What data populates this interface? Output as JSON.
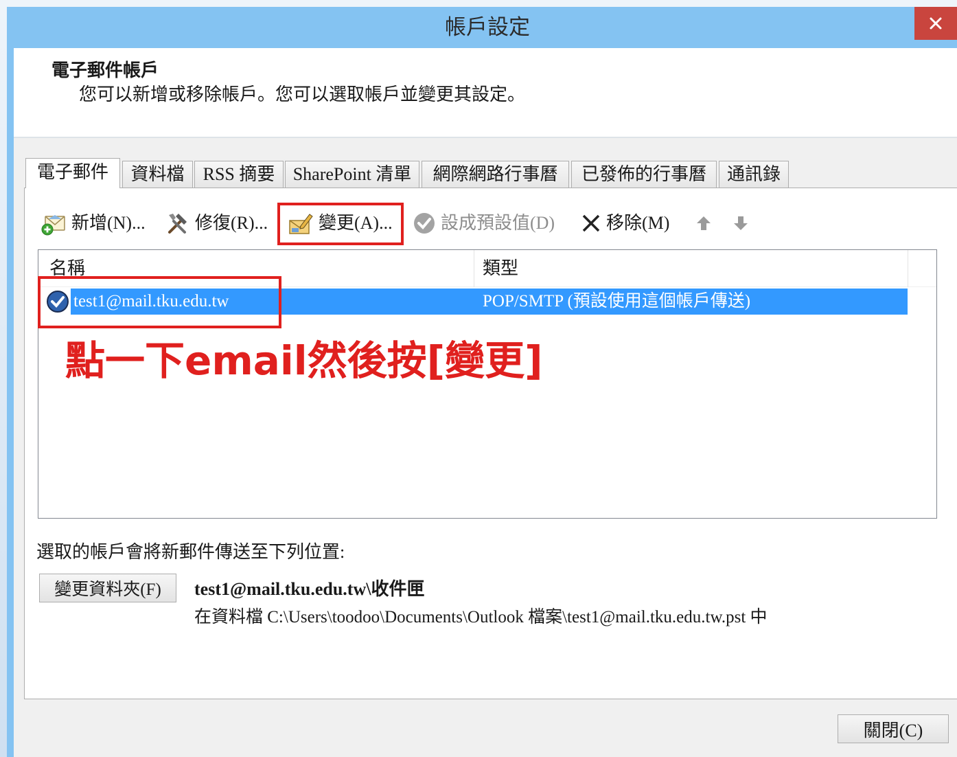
{
  "window": {
    "title": "帳戶設定",
    "close_icon": "close-icon"
  },
  "header": {
    "title": "電子郵件帳戶",
    "subtitle": "您可以新增或移除帳戶。您可以選取帳戶並變更其設定。"
  },
  "tabs": [
    {
      "label": "電子郵件",
      "selected": true
    },
    {
      "label": "資料檔",
      "selected": false
    },
    {
      "label": "RSS 摘要",
      "selected": false
    },
    {
      "label": "SharePoint 清單",
      "selected": false
    },
    {
      "label": "網際網路行事曆",
      "selected": false
    },
    {
      "label": "已發佈的行事曆",
      "selected": false
    },
    {
      "label": "通訊錄",
      "selected": false
    }
  ],
  "toolbar": {
    "new": {
      "label": "新增(N)...",
      "icon": "new-account-icon",
      "enabled": true
    },
    "repair": {
      "label": "修復(R)...",
      "icon": "repair-icon",
      "enabled": true
    },
    "change": {
      "label": "變更(A)...",
      "icon": "change-account-icon",
      "enabled": true
    },
    "set_default": {
      "label": "設成預設值(D)",
      "icon": "set-default-icon",
      "enabled": false
    },
    "remove": {
      "label": "移除(M)",
      "icon": "remove-icon",
      "enabled": true
    },
    "move_up": {
      "icon": "arrow-up-icon",
      "enabled": false
    },
    "move_down": {
      "icon": "arrow-down-icon",
      "enabled": false
    }
  },
  "account_list": {
    "columns": [
      "名稱",
      "類型"
    ],
    "rows": [
      {
        "name": "test1@mail.tku.edu.tw",
        "type": "POP/SMTP (預設使用這個帳戶傳送)",
        "selected": true,
        "icon": "default-account-icon"
      }
    ]
  },
  "annotation": {
    "text": "點一下email然後按[變更]"
  },
  "delivery": {
    "label": "選取的帳戶會將新郵件傳送至下列位置:",
    "change_folder_label": "變更資料夾(F)",
    "folder": "test1@mail.tku.edu.tw\\收件匣",
    "data_file": "在資料檔 C:\\Users\\toodoo\\Documents\\Outlook 檔案\\test1@mail.tku.edu.tw.pst 中"
  },
  "footer": {
    "close_label": "關閉(C)"
  },
  "colors": {
    "title_bar": "#84c3f2",
    "close_button": "#c9453e",
    "selection": "#3399ff",
    "annotation": "#e0201e"
  }
}
